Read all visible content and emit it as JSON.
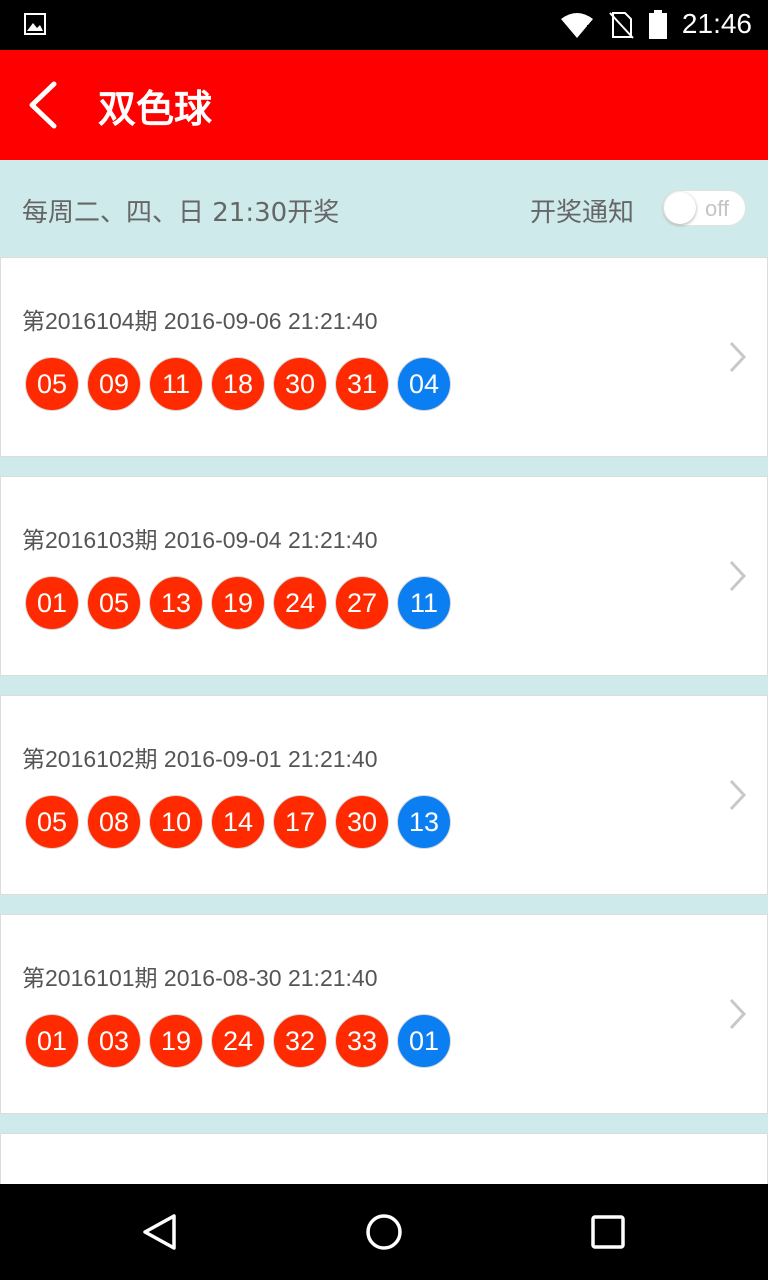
{
  "status_bar": {
    "time": "21:46",
    "icons": [
      "image-icon",
      "wifi-icon",
      "no-sim-icon",
      "battery-icon"
    ]
  },
  "app_bar": {
    "title": "双色球",
    "back_icon": "back-arrow-icon"
  },
  "info_bar": {
    "schedule": "每周二、四、日 21:30开奖",
    "notify_label": "开奖通知",
    "notify_toggle": {
      "state": "off",
      "label": "off"
    }
  },
  "draws": [
    {
      "title": "第2016104期 2016-09-06 21:21:40",
      "red": [
        "05",
        "09",
        "11",
        "18",
        "30",
        "31"
      ],
      "blue": "04"
    },
    {
      "title": "第2016103期 2016-09-04 21:21:40",
      "red": [
        "01",
        "05",
        "13",
        "19",
        "24",
        "27"
      ],
      "blue": "11"
    },
    {
      "title": "第2016102期 2016-09-01 21:21:40",
      "red": [
        "05",
        "08",
        "10",
        "14",
        "17",
        "30"
      ],
      "blue": "13"
    },
    {
      "title": "第2016101期 2016-08-30 21:21:40",
      "red": [
        "01",
        "03",
        "19",
        "24",
        "32",
        "33"
      ],
      "blue": "01"
    }
  ],
  "colors": {
    "app_bar": "#ff0000",
    "background": "#ceeaea",
    "red_ball": "#ff2a00",
    "blue_ball": "#0b7ef2"
  },
  "nav_bar": {
    "back": "nav-back-icon",
    "home": "nav-home-icon",
    "recents": "nav-recents-icon"
  }
}
